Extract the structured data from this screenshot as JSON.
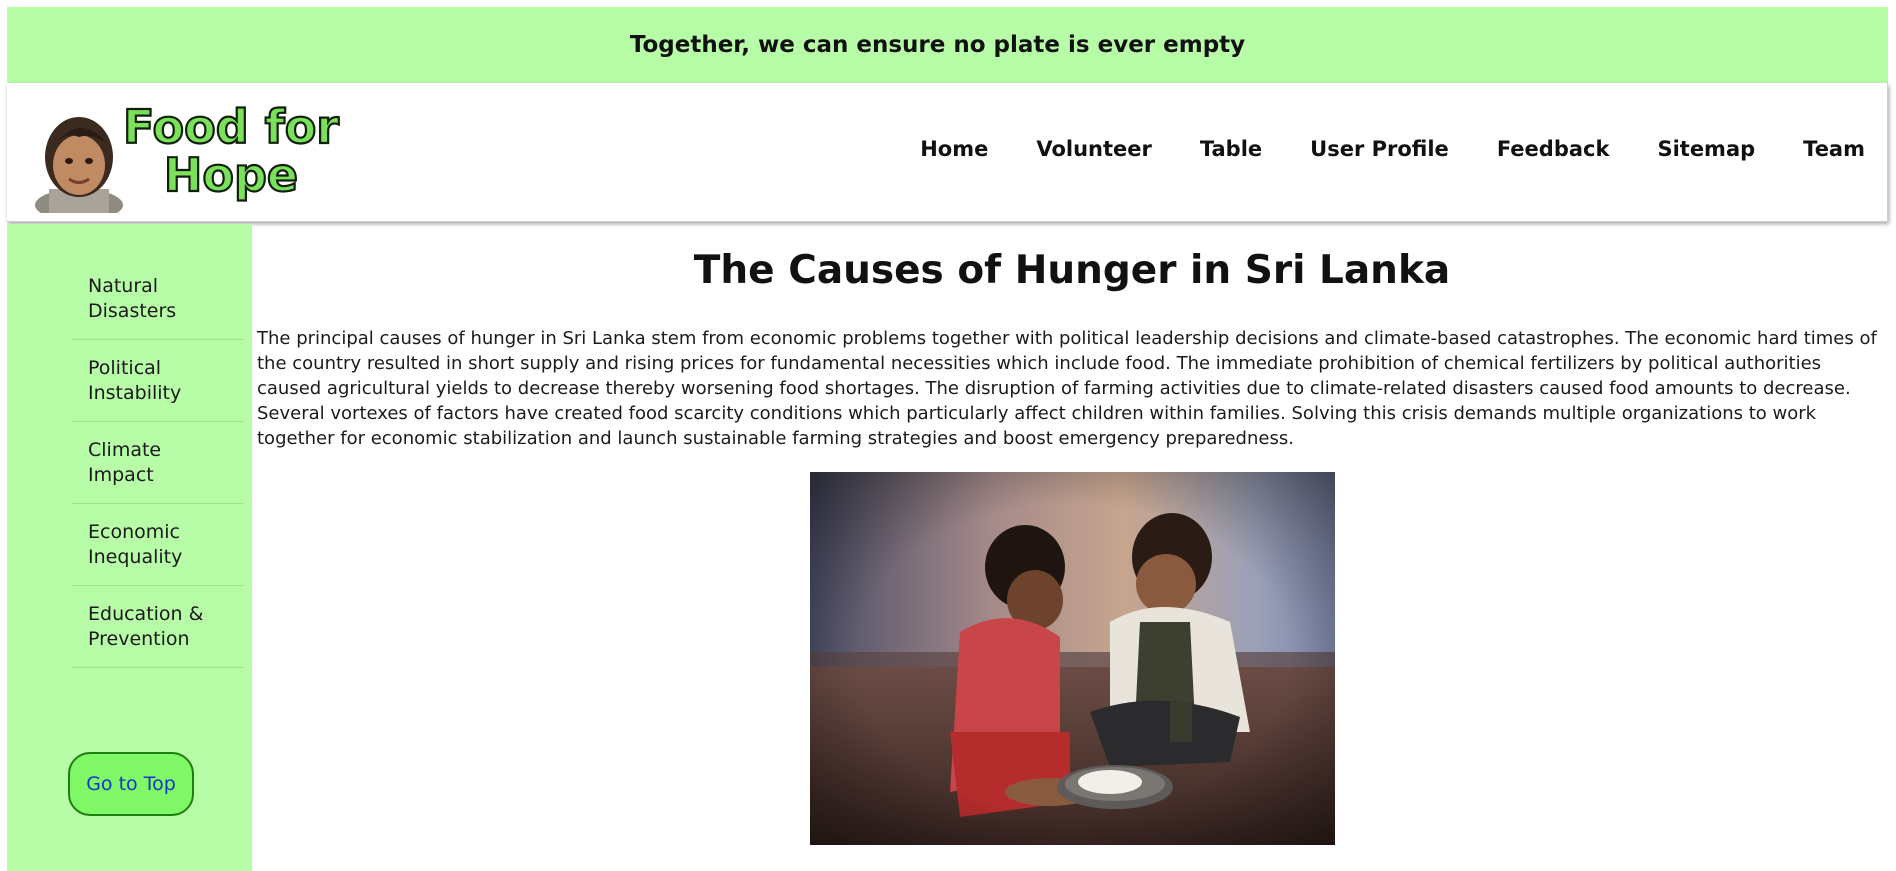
{
  "banner": {
    "text": "Together, we can ensure no plate is ever empty"
  },
  "header": {
    "logo_text_line1": "Food for",
    "logo_text_line2": "Hope",
    "nav": [
      {
        "label": "Home"
      },
      {
        "label": "Volunteer"
      },
      {
        "label": "Table"
      },
      {
        "label": "User Profile"
      },
      {
        "label": "Feedback"
      },
      {
        "label": "Sitemap"
      },
      {
        "label": "Team"
      }
    ]
  },
  "sidebar": {
    "items": [
      {
        "line1": "Natural",
        "line2": "Disasters"
      },
      {
        "line1": "Political",
        "line2": "Instability"
      },
      {
        "line1": "Climate",
        "line2": "Impact"
      },
      {
        "line1": "Economic",
        "line2": "Inequality"
      },
      {
        "line1": "Education &",
        "line2": "Prevention"
      }
    ],
    "top_button": "Go to Top"
  },
  "main": {
    "title": "The Causes of Hunger in Sri Lanka",
    "paragraph": "The principal causes of hunger in Sri Lanka stem from economic problems together with political leadership decisions and climate-based catastrophes. The economic hard times of the country resulted in short supply and rising prices for fundamental necessities which include food. The immediate prohibition of chemical fertilizers by political authorities caused agricultural yields to decrease thereby worsening food shortages. The disruption of farming activities due to climate-related disasters caused food amounts to decrease. Several vortexes of factors have created food scarcity conditions which particularly affect children within families. Solving this crisis demands multiple organizations to work together for economic stabilization and launch sustainable farming strategies and boost emergency preparedness."
  },
  "colors": {
    "accent_green": "#b7fca6",
    "button_green": "#7ff766",
    "link_blue": "#1438c6"
  }
}
